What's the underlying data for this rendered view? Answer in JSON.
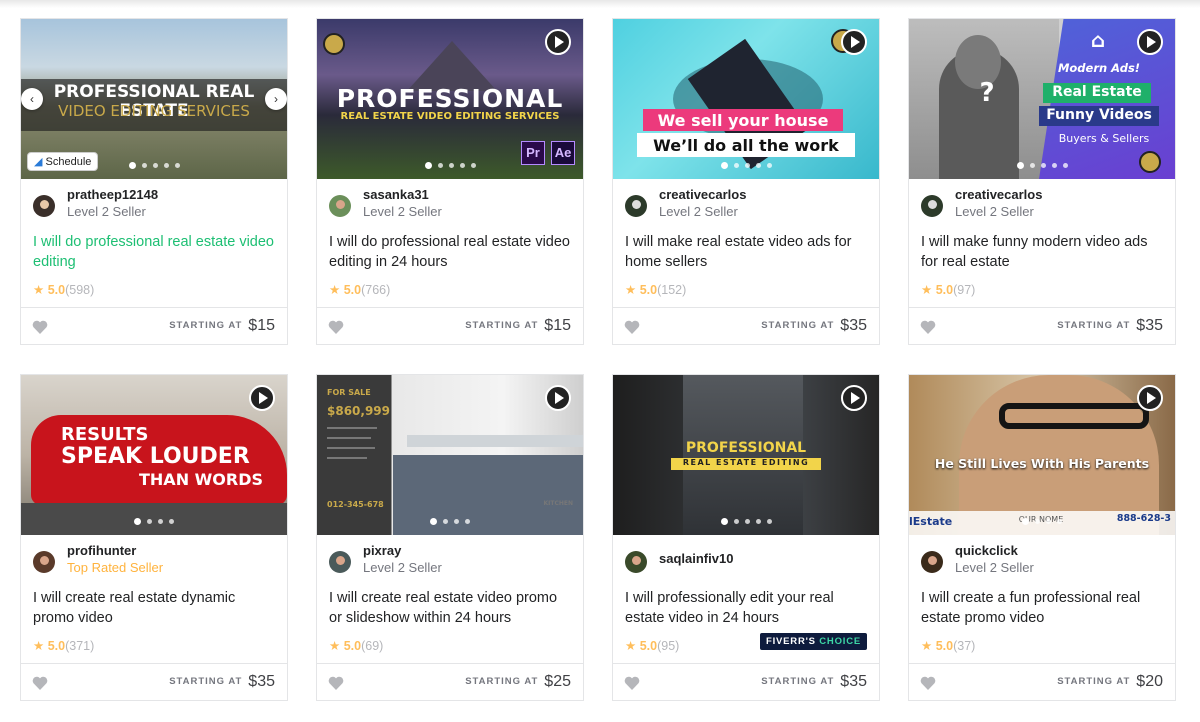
{
  "cards": [
    {
      "username": "pratheep12148",
      "level": "Level 2 Seller",
      "title": "I will do professional real estate video editing",
      "rating": "5.0",
      "reviews": "(598)",
      "starting_label": "STARTING AT",
      "price": "$15",
      "thumb_line1": "PROFESSIONAL REAL ESTATE",
      "thumb_line2": "VIDEO EDITING SERVICES",
      "schedule_label": "Schedule"
    },
    {
      "username": "sasanka31",
      "level": "Level 2 Seller",
      "title": "I will do professional real estate video editing in 24 hours",
      "rating": "5.0",
      "reviews": "(766)",
      "starting_label": "STARTING AT",
      "price": "$15",
      "thumb_line1": "PROFESSIONAL",
      "thumb_line2": "REAL ESTATE VIDEO EDITING SERVICES",
      "thumb_pr": "Pr",
      "thumb_ae": "Ae"
    },
    {
      "username": "creativecarlos",
      "level": "Level 2 Seller",
      "title": "I will make real estate video ads for home sellers",
      "rating": "5.0",
      "reviews": "(152)",
      "starting_label": "STARTING AT",
      "price": "$35",
      "thumb_line1": "We sell your house",
      "thumb_line2": "We’ll do all the work"
    },
    {
      "username": "creativecarlos",
      "level": "Level 2 Seller",
      "title": "I will make funny modern video ads for real estate",
      "rating": "5.0",
      "reviews": "(97)",
      "starting_label": "STARTING AT",
      "price": "$35",
      "thumb_line1": "Modern Ads!",
      "thumb_line2": "Real Estate",
      "thumb_line3": "Funny Videos",
      "thumb_line4": "Buyers & Sellers"
    },
    {
      "username": "profihunter",
      "level": "Top Rated Seller",
      "title": "I will create real estate dynamic promo video",
      "rating": "5.0",
      "reviews": "(371)",
      "starting_label": "STARTING AT",
      "price": "$35",
      "thumb_line1": "RESULTS",
      "thumb_line2": "SPEAK LOUDER",
      "thumb_line3": "THAN WORDS"
    },
    {
      "username": "pixray",
      "level": "Level 2 Seller",
      "title": "I will create real estate video promo or slideshow within 24 hours",
      "rating": "5.0",
      "reviews": "(69)",
      "starting_label": "STARTING AT",
      "price": "$25",
      "thumb_line1": "FOR SALE",
      "thumb_line2": "$860,999",
      "thumb_line3": "012-345-678",
      "thumb_line4": "KITCHEN"
    },
    {
      "username": "saqlainfiv10",
      "level": "",
      "title": "I will professionally edit your real estate video in 24 hours",
      "rating": "5.0",
      "reviews": "(95)",
      "starting_label": "STARTING AT",
      "price": "$35",
      "thumb_line1": "PROFESSIONAL",
      "thumb_line2": "REAL ESTATE EDITING",
      "badge_a": "FIVERR'S ",
      "badge_b": "CHOICE"
    },
    {
      "username": "quickclick",
      "level": "Level 2 Seller",
      "title": "I will create a fun professional real estate promo video",
      "rating": "5.0",
      "reviews": "(37)",
      "starting_label": "STARTING AT",
      "price": "$20",
      "thumb_line1": "He Still Lives With His Parents",
      "thumb_line2": "888-628-3",
      "thumb_line3": "lEstate",
      "thumb_line4": "OUR NOME"
    }
  ],
  "colors": {
    "green": "#1dbf73",
    "star": "#ffbe5b",
    "top_rated": "#ffb33e",
    "muted": "#74767e"
  }
}
